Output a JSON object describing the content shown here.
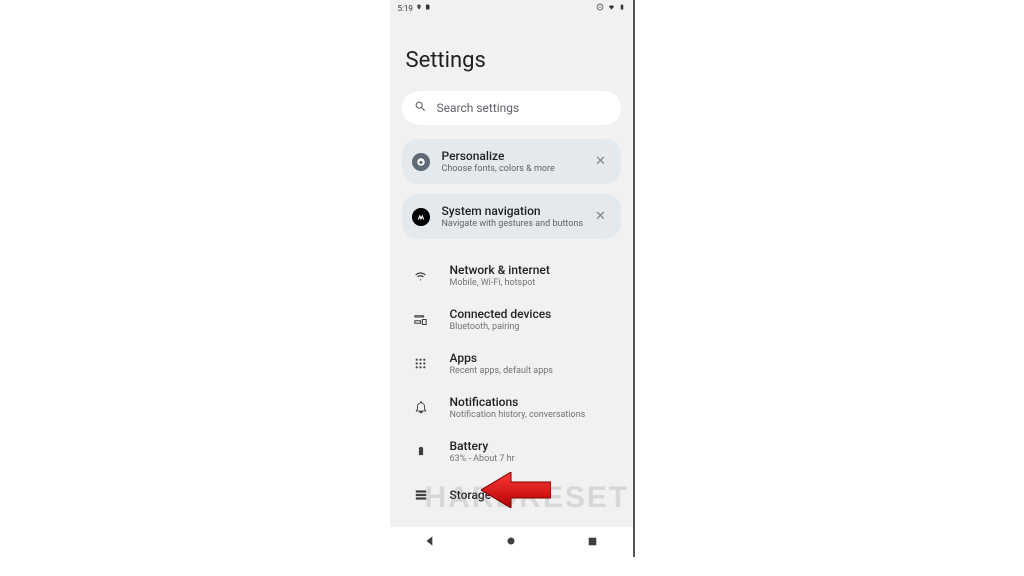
{
  "status": {
    "time": "5:19",
    "location_icon": "location-icon",
    "card_icon": "sim-card-icon"
  },
  "page": {
    "title": "Settings"
  },
  "search": {
    "placeholder": "Search settings"
  },
  "cards": [
    {
      "id": "personalize",
      "title": "Personalize",
      "subtitle": "Choose fonts, colors & more"
    },
    {
      "id": "sysnav",
      "title": "System navigation",
      "subtitle": "Navigate with gestures and buttons"
    }
  ],
  "rows": [
    {
      "id": "network",
      "title": "Network & internet",
      "subtitle": "Mobile, Wi-Fi, hotspot"
    },
    {
      "id": "connected",
      "title": "Connected devices",
      "subtitle": "Bluetooth, pairing"
    },
    {
      "id": "apps",
      "title": "Apps",
      "subtitle": "Recent apps, default apps"
    },
    {
      "id": "notifications",
      "title": "Notifications",
      "subtitle": "Notification history, conversations"
    },
    {
      "id": "battery",
      "title": "Battery",
      "subtitle": "63% - About 7 hr"
    },
    {
      "id": "storage",
      "title": "Storage",
      "subtitle": ""
    }
  ],
  "watermark": "HARDRESET"
}
